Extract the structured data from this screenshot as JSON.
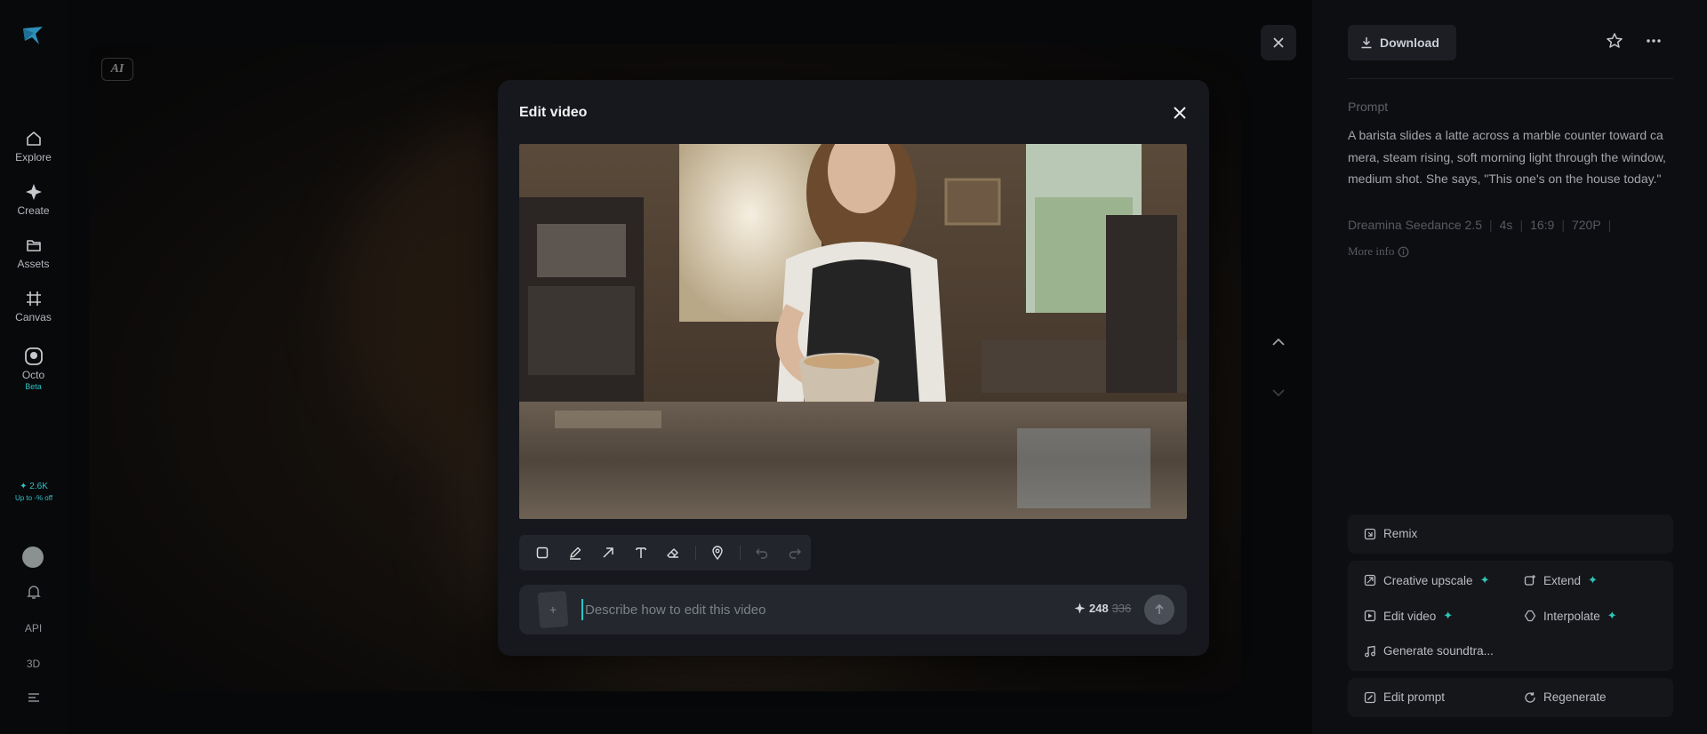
{
  "nav": {
    "items": [
      {
        "label": "Explore",
        "icon": "home-icon"
      },
      {
        "label": "Create",
        "icon": "sparkle-icon"
      },
      {
        "label": "Assets",
        "icon": "folder-icon"
      },
      {
        "label": "Canvas",
        "icon": "canvas-icon"
      },
      {
        "label": "Octo",
        "icon": "octo-icon",
        "badge": "Beta"
      }
    ],
    "credits": "2.6K",
    "credits_offer": "Up to -% off",
    "api_label": "API",
    "threed_label": "3D"
  },
  "preview": {
    "ai_badge": "AI"
  },
  "right_panel": {
    "download_label": "Download",
    "prompt_label": "Prompt",
    "prompt_text": "A barista slides a latte across a marble counter toward camera, steam rising, soft morning light through the window, medium shot. She says, \"This one's on the house today.\"",
    "meta": [
      "Dreamina Seedance 2.5",
      "4s",
      "16:9",
      "720P"
    ],
    "more_info": "More info",
    "actions": {
      "remix": "Remix",
      "creative_upscale": "Creative upscale",
      "extend": "Extend",
      "edit_video": "Edit video",
      "interpolate": "Interpolate",
      "generate_soundtrack": "Generate soundtra...",
      "edit_prompt": "Edit prompt",
      "regenerate": "Regenerate"
    }
  },
  "modal": {
    "title": "Edit video",
    "input_placeholder": "Describe how to edit this video",
    "input_value": "",
    "cost_now": "248",
    "cost_was": "336",
    "attach_symbol": "+"
  },
  "colors": {
    "accent": "#2cc6c6",
    "background": "#07080a",
    "panel": "#0d0e11",
    "modal": "#16181d"
  }
}
